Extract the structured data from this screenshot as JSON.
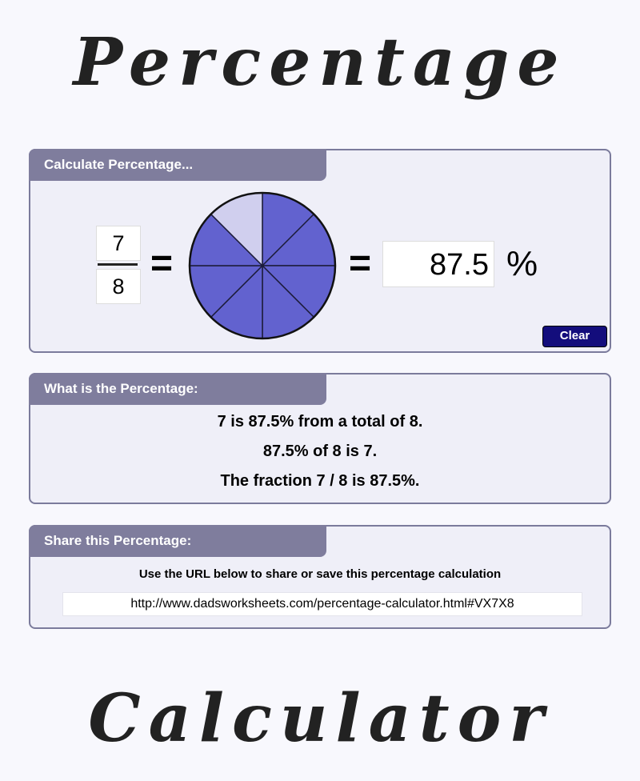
{
  "titles": {
    "top": "Percentage",
    "bottom": "Calculator"
  },
  "calculate_panel": {
    "header": "Calculate Percentage...",
    "numerator": "7",
    "denominator": "8",
    "equals": "=",
    "percent_value": "87.5",
    "percent_sign": "%",
    "clear_label": "Clear",
    "pie": {
      "slices": 8,
      "filled": 7,
      "filled_color": "#6262cf",
      "empty_color": "#d0cfee"
    }
  },
  "what_panel": {
    "header": "What is the Percentage:",
    "lines": [
      "7 is 87.5% from a total of 8.",
      "87.5% of 8 is 7.",
      "The fraction 7 / 8 is 87.5%."
    ]
  },
  "share_panel": {
    "header": "Share this Percentage:",
    "note": "Use the URL below to share or save this percentage calculation",
    "url": "http://www.dadsworksheets.com/percentage-calculator.html#VX7X8"
  }
}
